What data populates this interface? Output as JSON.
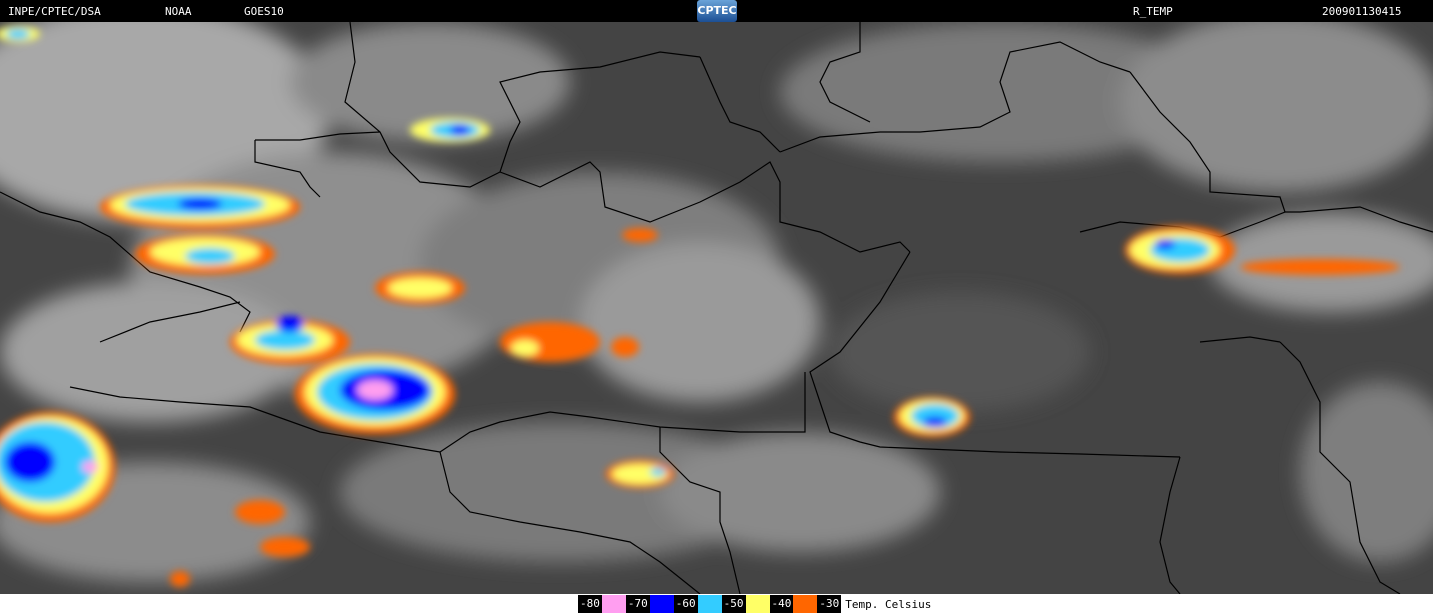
{
  "header": {
    "institution": "INPE/CPTEC/DSA",
    "agency": "NOAA",
    "satellite": "GOES10",
    "logo_text": "CPTEC",
    "product": "R_TEMP",
    "timestamp": "200901130415"
  },
  "colors": {
    "background_dark": "#3c3c3c",
    "cloud_light": "#bdbdbd",
    "border": "#000000",
    "pink": "#ff9ef0",
    "blue": "#0000ff",
    "cyan": "#33ccff",
    "yellow": "#ffff66",
    "orange": "#ff6600"
  },
  "legend": {
    "items": [
      {
        "label": "-80",
        "color": "#ff9ef0"
      },
      {
        "label": "-70",
        "color": "#0000ff"
      },
      {
        "label": "-60",
        "color": "#33ccff"
      },
      {
        "label": "-50",
        "color": "#ffff66"
      },
      {
        "label": "-40",
        "color": "#ff6600"
      },
      {
        "label": "-30",
        "color": ""
      }
    ],
    "caption": "Temp. Celsius"
  }
}
